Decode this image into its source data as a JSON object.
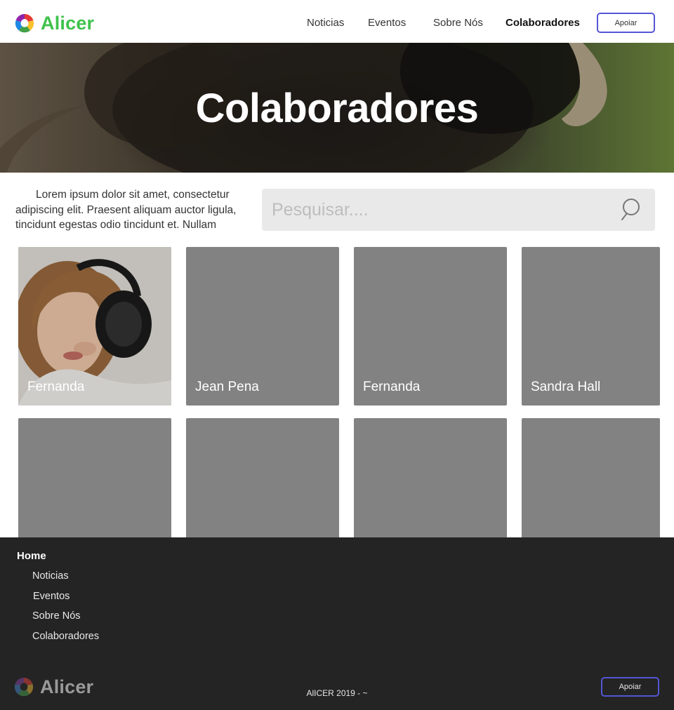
{
  "brand": {
    "name": "Alicer"
  },
  "nav": {
    "items": [
      "Noticias",
      "Eventos",
      "Sobre Nós",
      "Colaboradores"
    ],
    "active": "Colaboradores",
    "cta": "Apoiar"
  },
  "hero": {
    "title": "Colaboradores"
  },
  "intro": {
    "text": "Lorem ipsum dolor sit amet, consectetur adipiscing elit. Praesent aliquam auctor ligula, tincidunt egestas odio tincidunt et. Nullam"
  },
  "search": {
    "placeholder": "Pesquisar...."
  },
  "collaborators": [
    {
      "name": "Fernanda",
      "has_photo": true
    },
    {
      "name": "Jean Pena",
      "has_photo": false
    },
    {
      "name": "Fernanda",
      "has_photo": false
    },
    {
      "name": "Sandra Hall",
      "has_photo": false
    },
    {
      "name": "",
      "has_photo": false
    },
    {
      "name": "",
      "has_photo": false
    },
    {
      "name": "",
      "has_photo": false
    },
    {
      "name": "",
      "has_photo": false
    }
  ],
  "footer": {
    "home": "Home",
    "links": [
      "Noticias",
      "Eventos",
      "Sobre Nós",
      "Colaboradores"
    ],
    "copyright": "AlICER 2019 - ~",
    "cta": "Apoiar"
  },
  "colors": {
    "brand_green": "#3fc24b",
    "accent_blue": "#5456d6",
    "card_gray": "#828282",
    "footer_bg": "#242424"
  }
}
